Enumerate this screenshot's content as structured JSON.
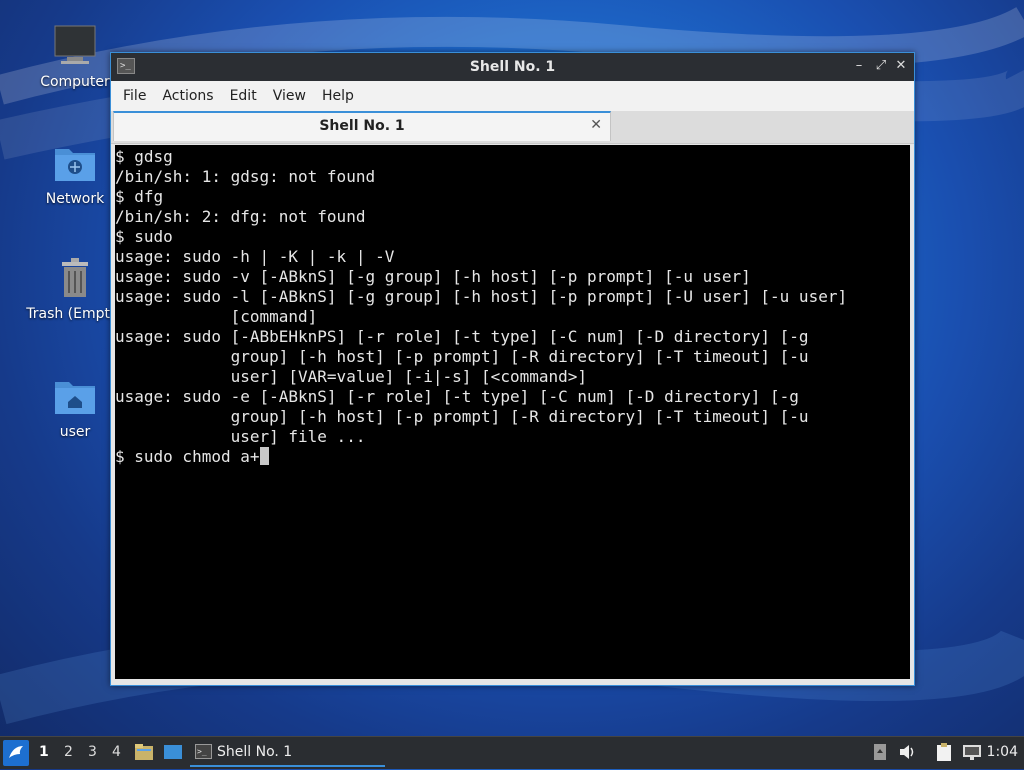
{
  "desktop": {
    "icons": [
      {
        "label": "Computer",
        "icon": "computer-icon"
      },
      {
        "label": "Network",
        "icon": "network-folder-icon"
      },
      {
        "label": "Trash (Empty)",
        "icon": "trash-icon"
      },
      {
        "label": "user",
        "icon": "home-folder-icon"
      }
    ]
  },
  "window": {
    "title": "Shell No. 1",
    "controls": {
      "minimize": "–",
      "maximize": "⤢",
      "close": "✕"
    },
    "menu": [
      "File",
      "Actions",
      "Edit",
      "View",
      "Help"
    ],
    "tab": {
      "label": "Shell No. 1",
      "close": "✕"
    }
  },
  "terminal": {
    "lines": [
      "$ gdsg",
      "/bin/sh: 1: gdsg: not found",
      "$ dfg",
      "/bin/sh: 2: dfg: not found",
      "$ sudo",
      "usage: sudo -h | -K | -k | -V",
      "usage: sudo -v [-ABknS] [-g group] [-h host] [-p prompt] [-u user]",
      "usage: sudo -l [-ABknS] [-g group] [-h host] [-p prompt] [-U user] [-u user]",
      "            [command]",
      "usage: sudo [-ABbEHknPS] [-r role] [-t type] [-C num] [-D directory] [-g",
      "            group] [-h host] [-p prompt] [-R directory] [-T timeout] [-u",
      "            user] [VAR=value] [-i|-s] [<command>]",
      "usage: sudo -e [-ABknS] [-r role] [-t type] [-C num] [-D directory] [-g",
      "            group] [-h host] [-p prompt] [-R directory] [-T timeout] [-u",
      "            user] file ...",
      "$ sudo chmod a+"
    ]
  },
  "taskbar": {
    "workspaces": [
      "1",
      "2",
      "3",
      "4"
    ],
    "active_workspace": "1",
    "task_label": "Shell No. 1",
    "clock": "1:04"
  },
  "colors": {
    "accent": "#3a8fd8",
    "titlebar": "#2b2e33",
    "terminal_bg": "#000000",
    "terminal_fg": "#e6e6e6",
    "taskbar": "#2a2d31"
  }
}
